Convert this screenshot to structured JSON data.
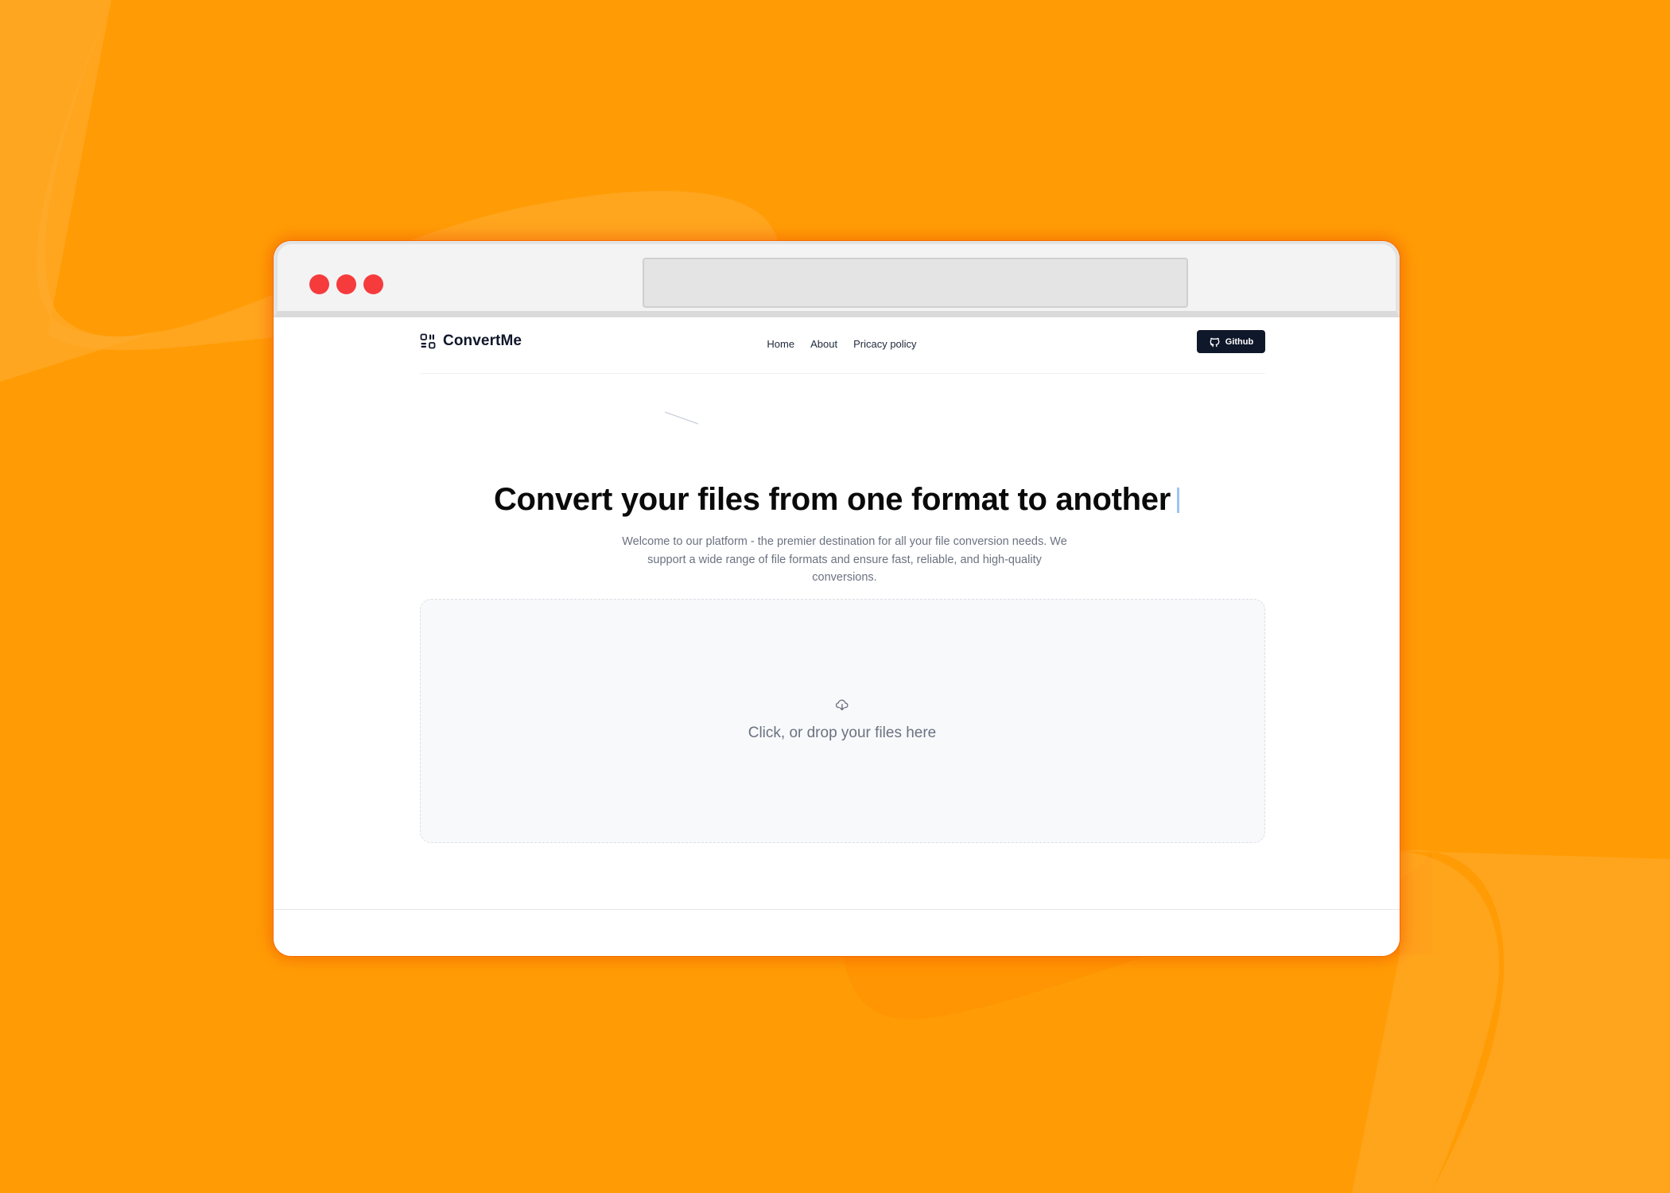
{
  "app": {
    "name": "ConvertMe",
    "logo_icon": "grid-icon"
  },
  "nav": {
    "links": [
      {
        "label": "Home"
      },
      {
        "label": "About"
      },
      {
        "label": "Pricacy policy"
      }
    ],
    "github_label": "Github",
    "github_icon": "github-icon"
  },
  "hero": {
    "title": "Convert your files from one format to another",
    "subtitle": "Welcome to our platform - the premier destination for all your file conversion needs. We support a wide range of file formats and ensure fast, reliable, and high-quality conversions."
  },
  "dropzone": {
    "label": "Click, or drop your files here",
    "icon": "cloud-download-icon"
  },
  "colors": {
    "background": "#ff9c05",
    "window_dots": "#f63b3d",
    "primary_button": "#0f172a",
    "cursor": "#9cc4ef"
  }
}
